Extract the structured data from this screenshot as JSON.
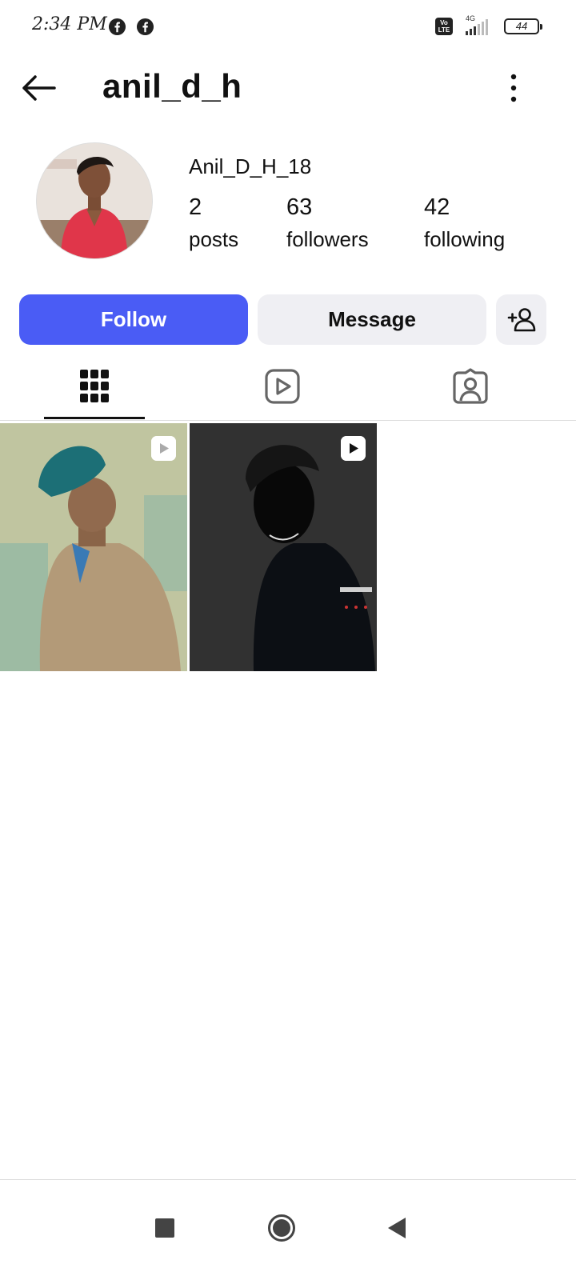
{
  "status_bar": {
    "time": "2:34 PM",
    "notification_icons": [
      "facebook-icon",
      "facebook-icon"
    ],
    "volte_label": "Vo LTE",
    "network_type": "4G",
    "battery_level": "44"
  },
  "header": {
    "username": "anil_d_h",
    "back_icon": "back-arrow-icon",
    "more_icon": "more-vertical-icon"
  },
  "profile": {
    "display_name": "Anil_D_H_18",
    "stats": [
      {
        "value": "2",
        "label": "posts"
      },
      {
        "value": "63",
        "label": "followers"
      },
      {
        "value": "42",
        "label": "following"
      }
    ]
  },
  "actions": {
    "follow_label": "Follow",
    "message_label": "Message",
    "suggest_icon": "add-person-icon"
  },
  "tabs": [
    {
      "icon": "grid-icon",
      "active": true
    },
    {
      "icon": "reels-icon",
      "active": false
    },
    {
      "icon": "tagged-icon",
      "active": false
    }
  ],
  "posts": [
    {
      "type": "reel",
      "badge_icon": "reel-badge-icon"
    },
    {
      "type": "reel",
      "badge_icon": "reel-badge-icon"
    }
  ],
  "nav_bar": [
    "recents-square-icon",
    "home-circle-icon",
    "back-triangle-icon"
  ],
  "colors": {
    "follow_button": "#4a5cf5",
    "secondary_button": "#efeff3",
    "text": "#111111"
  }
}
